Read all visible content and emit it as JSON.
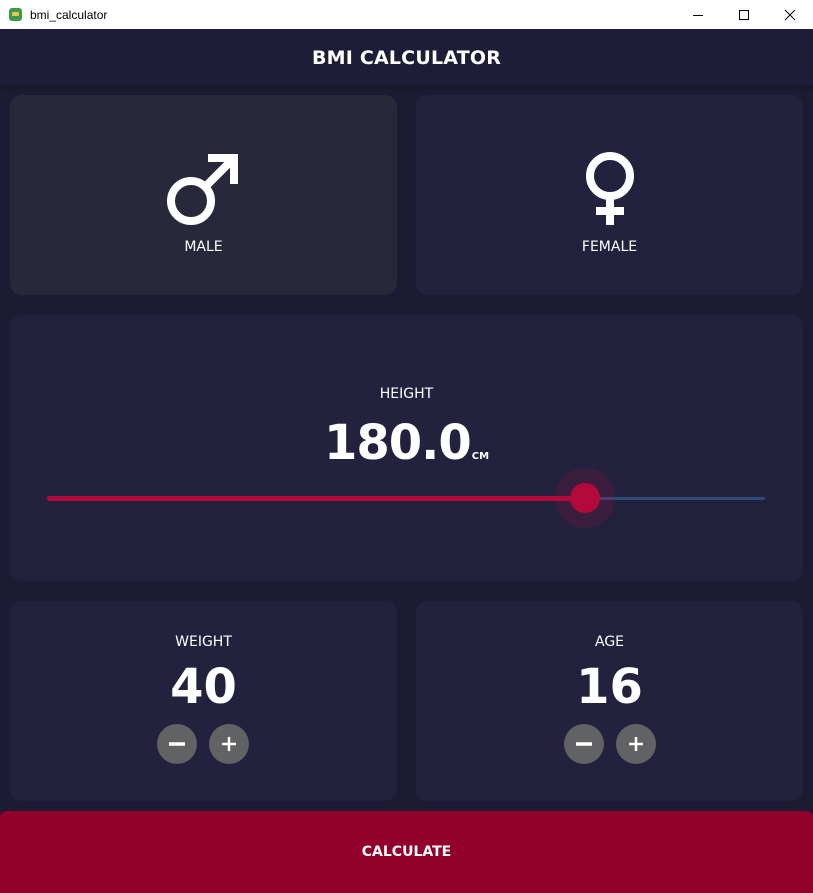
{
  "window": {
    "title": "bmi_calculator",
    "icon": "app-icon",
    "controls": [
      "minimize-icon",
      "maximize-icon",
      "close-icon"
    ]
  },
  "appbar": {
    "title": "BMI CALCULATOR"
  },
  "gender": {
    "selected": "male",
    "male": {
      "label": "MALE",
      "icon": "male-symbol-icon"
    },
    "female": {
      "label": "FEMALE",
      "icon": "female-symbol-icon"
    }
  },
  "height": {
    "label": "HEIGHT",
    "value": "180.0",
    "unit": "CM",
    "slider_fraction": 0.75
  },
  "weight": {
    "label": "WEIGHT",
    "value": "40",
    "decrement_icon": "minus-icon",
    "increment_icon": "plus-icon"
  },
  "age": {
    "label": "AGE",
    "value": "16",
    "decrement_icon": "minus-icon",
    "increment_icon": "plus-icon"
  },
  "calculate": {
    "label": "CALCULATE"
  },
  "colors": {
    "background": "#1c1b33",
    "card": "#22223f",
    "card_active": "#272839",
    "accent": "#b30a3b",
    "calculate_button": "#92002c",
    "round_button": "#626265",
    "slider_inactive": "#2e4b78"
  }
}
